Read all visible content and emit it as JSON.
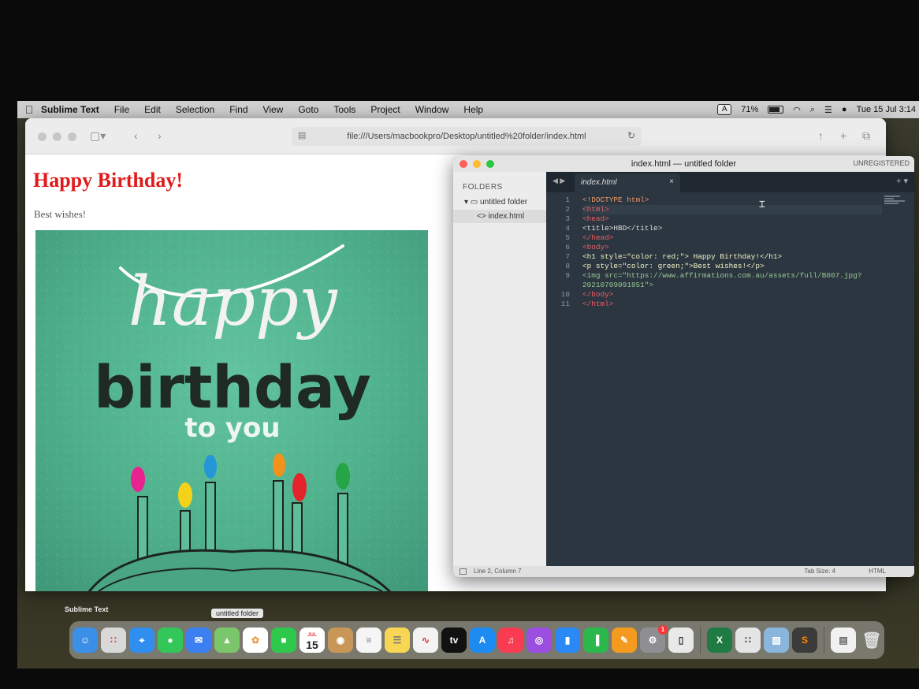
{
  "menubar": {
    "items": [
      "Sublime Text",
      "File",
      "Edit",
      "Selection",
      "Find",
      "View",
      "Goto",
      "Tools",
      "Project",
      "Window",
      "Help"
    ],
    "input_source": "A",
    "battery": "71%",
    "clock": "Tue 15 Jul 3:14"
  },
  "safari": {
    "url": "file:///Users/macbookpro/Desktop/untitled%20folder/index.html",
    "page": {
      "heading": "Happy Birthday!",
      "subtext": "Best wishes!",
      "card": {
        "line1": "happy",
        "line2": "birthday",
        "line3": "to you"
      }
    }
  },
  "sublime": {
    "title": "index.html — untitled folder",
    "unregistered": "UNREGISTERED",
    "sidebar": {
      "header": "FOLDERS",
      "folder": "untitled folder",
      "file": "index.html"
    },
    "tab": "index.html",
    "line_numbers": [
      "1",
      "2",
      "3",
      "4",
      "5",
      "6",
      "7",
      "8",
      "9",
      "",
      "10",
      "11"
    ],
    "code_lines": [
      "<!DOCTYPE html>",
      "<html>",
      "<head>",
      "    <title>HBD</title>",
      "</head>",
      "<body>",
      "<h1 style=\"color: red;\"> Happy Birthday!</h1>",
      "<p  style=\"color: green;\">Best wishes!</p>",
      "<img src=\"https://www.affirmations.com.au/assets/full/B007.jpg?",
      "20210709091851\">",
      "</body>",
      "</html>"
    ],
    "status": {
      "position": "Line 2, Column 7",
      "tab_size": "Tab Size: 4",
      "syntax": "HTML"
    }
  },
  "dock": {
    "active_label": "Sublime Text",
    "tooltip": "untitled folder",
    "calendar_day": "15",
    "calendar_month": "JUL",
    "settings_badge": "1"
  }
}
